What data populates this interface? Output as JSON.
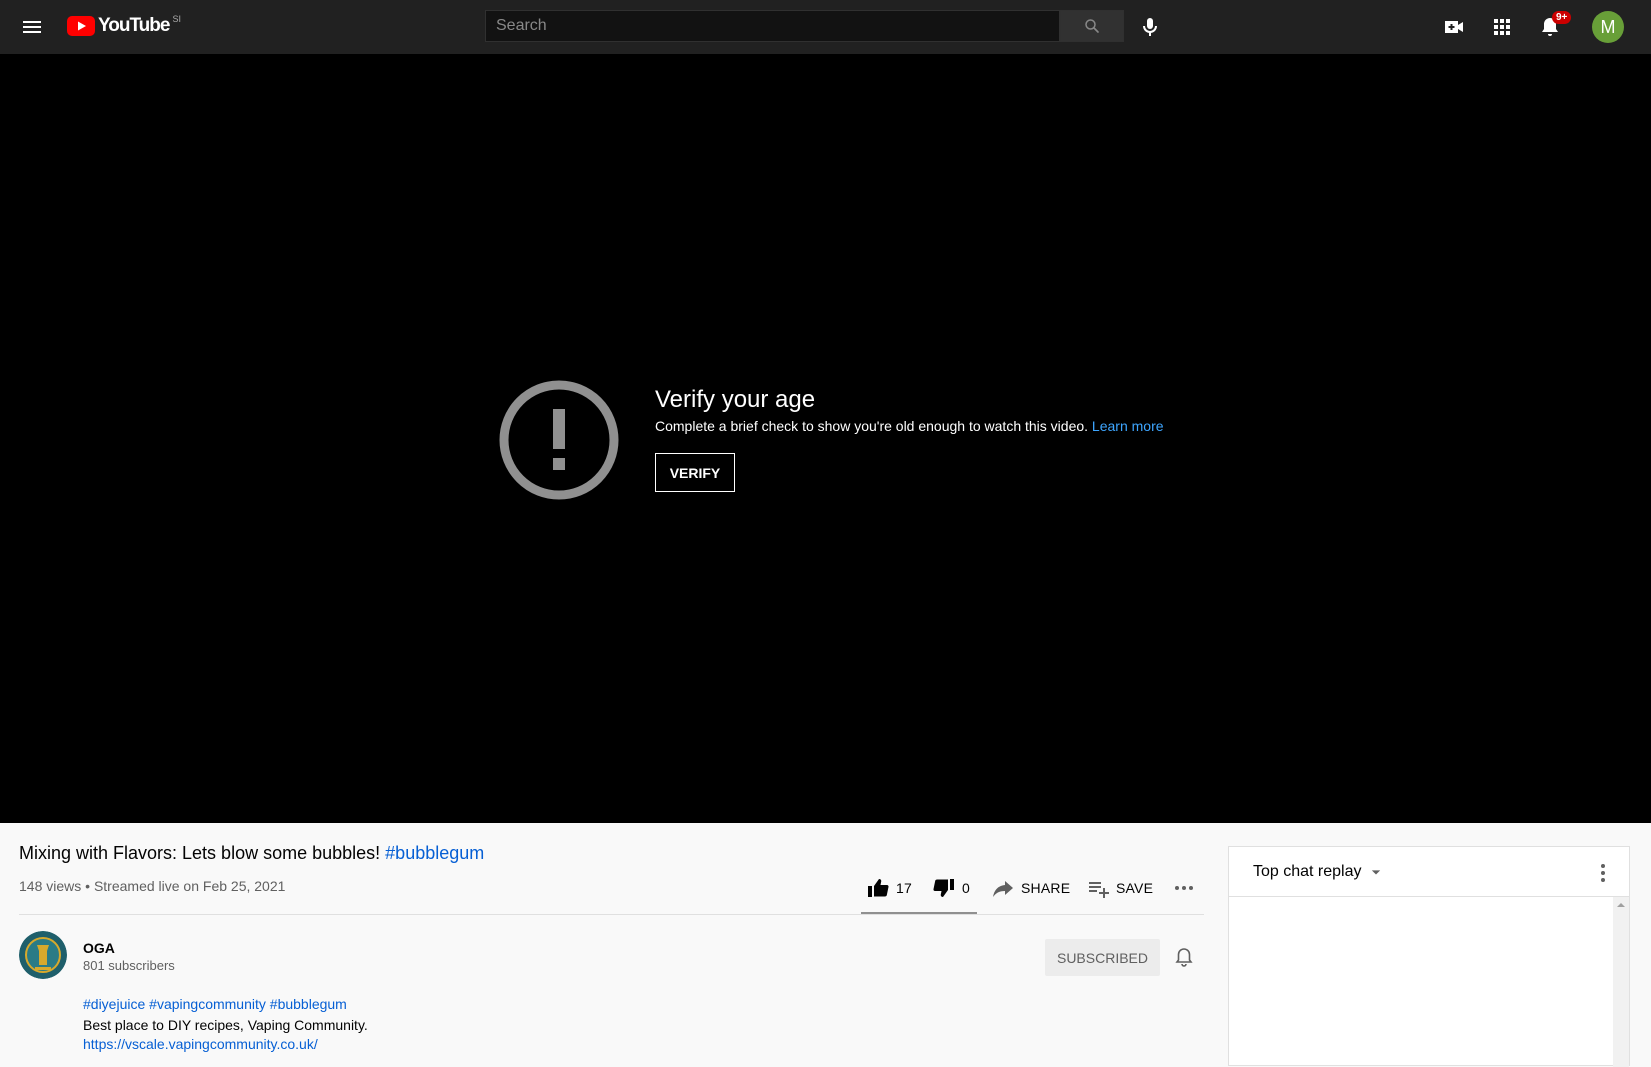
{
  "masthead": {
    "logo_text": "YouTube",
    "country_code": "SI",
    "search_placeholder": "Search",
    "notification_count": "9+",
    "avatar_letter": "M"
  },
  "player": {
    "age_gate_title": "Verify your age",
    "age_gate_description": "Complete a brief check to show you're old enough to watch this video.",
    "learn_more": "Learn more",
    "verify_label": "VERIFY"
  },
  "video": {
    "title": "Mixing with Flavors: Lets blow some bubbles!",
    "title_hashtag": "#bubblegum",
    "views": "148 views",
    "streamed": "Streamed live on Feb 25, 2021",
    "likes": "17",
    "dislikes": "0",
    "like_fraction": 1.0,
    "share_label": "SHARE",
    "save_label": "SAVE"
  },
  "channel": {
    "name": "OGA",
    "subscribers": "801 subscribers",
    "subscribed_label": "SUBSCRIBED"
  },
  "description": {
    "tags": [
      "#diyejuice",
      "#vapingcommunity",
      "#bubblegum"
    ],
    "line1": "Best place to DIY recipes, Vaping Community.",
    "link": "https://vscale.vapingcommunity.co.uk/"
  },
  "chat": {
    "title": "Top chat replay"
  },
  "colors": {
    "masthead_bg": "#212121",
    "player_bg": "#000000",
    "link_blue": "#065fd4",
    "learn_more_blue": "#3ea6ff",
    "youtube_red": "#ff0000",
    "badge_red": "#cc0000",
    "avatar_green": "#689f38"
  }
}
